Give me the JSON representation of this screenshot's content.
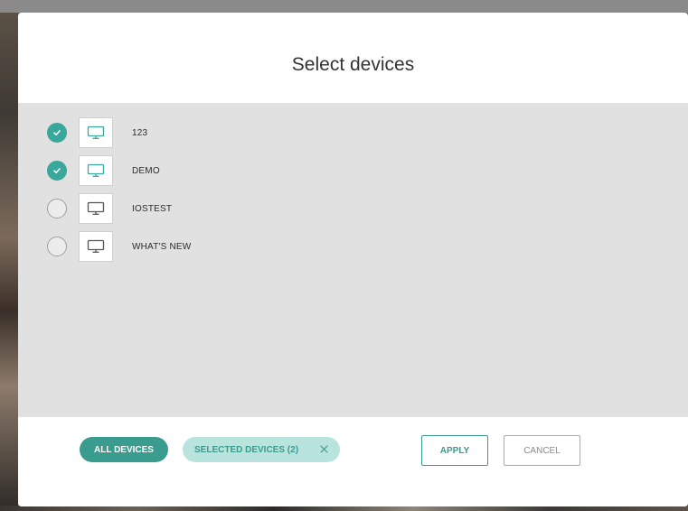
{
  "dialog": {
    "title": "Select devices"
  },
  "devices": [
    {
      "name": "123",
      "selected": true,
      "icon": "monitor-icon"
    },
    {
      "name": "DEMO",
      "selected": true,
      "icon": "monitor-icon"
    },
    {
      "name": "IOSTEST",
      "selected": false,
      "icon": "monitor-icon"
    },
    {
      "name": "WHAT'S NEW",
      "selected": false,
      "icon": "monitor-icon"
    }
  ],
  "filters": {
    "all_label": "ALL DEVICES",
    "selected_label": "SELECTED DEVICES (2)",
    "clear_icon": "close-icon"
  },
  "actions": {
    "apply_label": "APPLY",
    "cancel_label": "CANCEL"
  },
  "colors": {
    "accent": "#3a9b8f",
    "accent_light": "#b8e4dd",
    "list_background": "#e1e1e1"
  }
}
